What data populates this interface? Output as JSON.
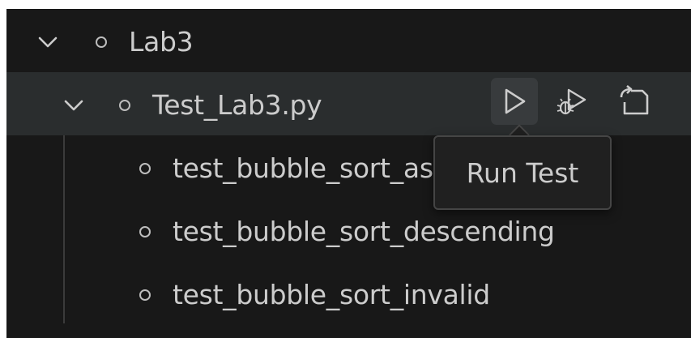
{
  "tree": {
    "root": {
      "label": "Lab3",
      "expanded": true,
      "chevron_icon": "chevron-down-icon",
      "status_icon": "circle-outline-icon"
    },
    "file": {
      "label": "Test_Lab3.py",
      "expanded": true,
      "selected": true,
      "chevron_icon": "chevron-down-icon",
      "status_icon": "circle-outline-icon",
      "actions": [
        {
          "icon": "run-test-icon",
          "hovered": true
        },
        {
          "icon": "debug-test-icon",
          "hovered": false
        },
        {
          "icon": "go-to-test-icon",
          "hovered": false
        }
      ]
    },
    "tests": [
      {
        "label": "test_bubble_sort_ascending",
        "status_icon": "circle-outline-icon"
      },
      {
        "label": "test_bubble_sort_descending",
        "status_icon": "circle-outline-icon"
      },
      {
        "label": "test_bubble_sort_invalid",
        "status_icon": "circle-outline-icon"
      }
    ]
  },
  "tooltip": {
    "text": "Run Test"
  },
  "colors": {
    "background": "#181818",
    "selected_row": "#2a2d2e",
    "text": "#cccccc",
    "focus_border": "#0078d4",
    "tooltip_bg": "#202020",
    "tooltip_border": "#454545"
  }
}
